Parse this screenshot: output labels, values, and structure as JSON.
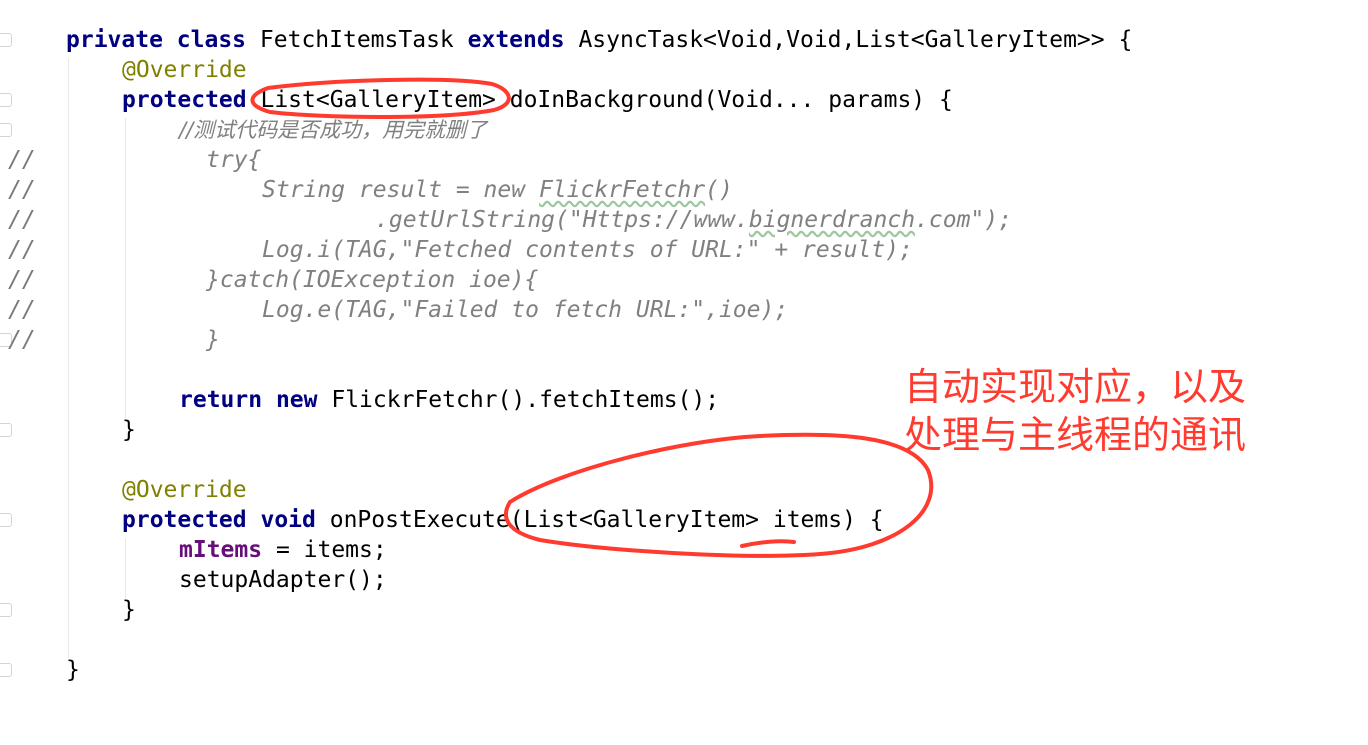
{
  "editor": {
    "line_comment_marker": "//",
    "lines": {
      "l1": {
        "kw1": "private",
        "kw2": "class",
        "name": "FetchItemsTask",
        "kw3": "extends",
        "rest": "AsyncTask<Void,Void,List<GalleryItem>> {"
      },
      "l2": {
        "annotation": "@Override"
      },
      "l3": {
        "kw": "protected",
        "rest": "List<GalleryItem> doInBackground(Void... params) {"
      },
      "l4": {
        "comment": "//测试代码是否成功，用完就删了"
      },
      "l5": {
        "text": "try{"
      },
      "l6": {
        "before": "String result = new ",
        "wavy": "FlickrFetchr",
        "after": "()"
      },
      "l7": {
        "before": ".getUrlString(\"Https://www.",
        "wavy": "bignerdranch",
        "after": ".com\");"
      },
      "l8": {
        "text": "Log.i(TAG,\"Fetched contents of URL:\" + result);"
      },
      "l9": {
        "text": "}catch(IOException ioe){"
      },
      "l10": {
        "text": "Log.e(TAG,\"Failed to fetch URL:\",ioe);"
      },
      "l11": {
        "text": "}"
      },
      "l13": {
        "kw1": "return",
        "kw2": "new",
        "rest": "FlickrFetchr().fetchItems();"
      },
      "l14": {
        "text": "}"
      },
      "l16": {
        "annotation": "@Override"
      },
      "l17": {
        "kw1": "protected",
        "kw2": "void",
        "rest": "onPostExecute(List<GalleryItem> items) {"
      },
      "l18": {
        "field": "mItems",
        "rest": " = items;"
      },
      "l19": {
        "text": "setupAdapter();"
      },
      "l20": {
        "text": "}"
      },
      "l22": {
        "text": "}"
      }
    }
  },
  "annotation_note": {
    "line1": "自动实现对应，以及",
    "line2": "处理与主线程的通讯",
    "color": "#ff3b30"
  },
  "colors": {
    "keyword": "#000080",
    "annotation": "#808000",
    "field": "#660e7a",
    "comment": "#808080",
    "background": "#ffffff"
  }
}
